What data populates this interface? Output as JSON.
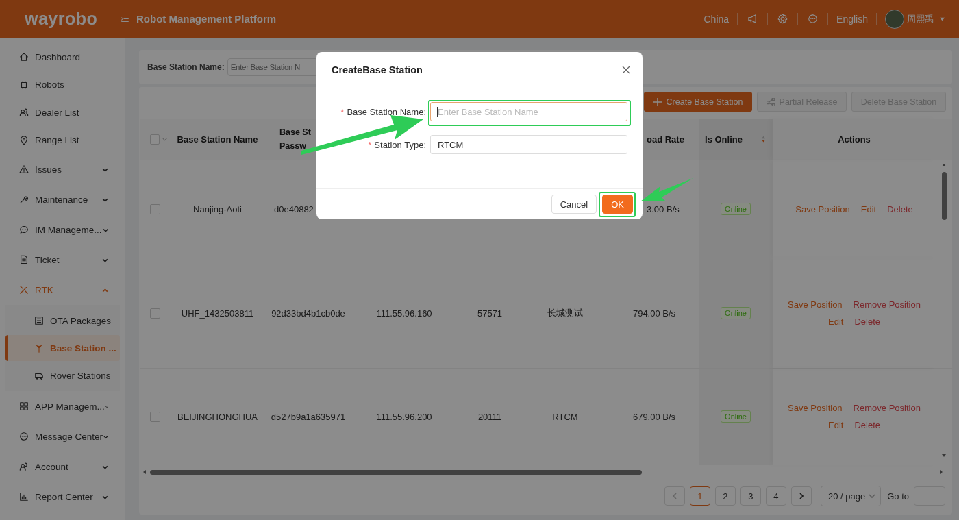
{
  "header": {
    "logo": "wayrobo",
    "title": "Robot Management Platform",
    "region": "China",
    "language": "English",
    "user": "周熙禹"
  },
  "sidebar": {
    "items": [
      {
        "label": "Dashboard",
        "kind": "link",
        "selected": false
      },
      {
        "label": "Robots",
        "kind": "link",
        "selected": false
      },
      {
        "label": "Dealer List",
        "kind": "link",
        "selected": false
      },
      {
        "label": "Range List",
        "kind": "link",
        "selected": false
      },
      {
        "label": "Issues",
        "kind": "group",
        "expanded": false,
        "selected": false
      },
      {
        "label": "Maintenance",
        "kind": "group",
        "expanded": false,
        "selected": false
      },
      {
        "label": "IM Manageme...",
        "kind": "group",
        "expanded": false,
        "selected": false
      },
      {
        "label": "Ticket",
        "kind": "group",
        "expanded": false,
        "selected": false
      },
      {
        "label": "RTK",
        "kind": "group",
        "expanded": true,
        "selected": true,
        "children": [
          {
            "label": "OTA Packages",
            "selected": false
          },
          {
            "label": "Base Station ...",
            "selected": true
          },
          {
            "label": "Rover Stations",
            "selected": false
          }
        ]
      },
      {
        "label": "APP Managem...",
        "kind": "group",
        "expanded": false,
        "selected": false
      },
      {
        "label": "Message Center",
        "kind": "group",
        "expanded": false,
        "selected": false
      },
      {
        "label": "Account",
        "kind": "group",
        "expanded": false,
        "selected": false
      },
      {
        "label": "Report Center",
        "kind": "group",
        "expanded": false,
        "selected": false
      }
    ]
  },
  "filter": {
    "label": "Base Station Name:",
    "placeholder": "Enter Base Station N"
  },
  "toolbar": [
    {
      "label": "Create Base Station",
      "kind": "create",
      "disabled": false
    },
    {
      "label": "Partial Release",
      "kind": "release",
      "disabled": true
    },
    {
      "label": "Delete Base Station",
      "kind": "plain",
      "disabled": true
    }
  ],
  "table": {
    "header": {
      "all_selected": false,
      "name": "Base Station Name",
      "password": [
        "Base St",
        "Passw"
      ],
      "rate": "oad Rate",
      "online": "Is Online",
      "descending": true,
      "actions": "Actions"
    },
    "rows": [
      {
        "selected": false,
        "name": "Nanjing-Aoti",
        "password": "d0e40882",
        "rate": "3.00 B/s",
        "status": "Online",
        "online": true,
        "actions": [
          {
            "label": "Save Position",
            "kind": "primary"
          },
          {
            "label": "Edit",
            "kind": "primary"
          },
          {
            "label": "Delete",
            "kind": "danger"
          }
        ]
      },
      {
        "selected": false,
        "name": "UHF_1432503811",
        "password": "92d33bd4b1cb0de",
        "ip": "111.55.96.160",
        "port": "57571",
        "type": "长城测试",
        "rate": "794.00 B/s",
        "status": "Online",
        "online": true,
        "actions": [
          {
            "label": "Save Position",
            "kind": "primary"
          },
          {
            "label": "Remove Position",
            "kind": "danger"
          },
          {
            "label": "Edit",
            "kind": "primary"
          },
          {
            "label": "Delete",
            "kind": "danger"
          }
        ]
      },
      {
        "selected": false,
        "name": "BEIJINGHONGHUA",
        "password": "d527b9a1a635971",
        "ip": "111.55.96.200",
        "port": "20111",
        "type": "RTCM",
        "rate": "679.00 B/s",
        "status": "Online",
        "online": true,
        "actions": [
          {
            "label": "Save Position",
            "kind": "primary"
          },
          {
            "label": "Remove Position",
            "kind": "danger"
          },
          {
            "label": "Edit",
            "kind": "primary"
          },
          {
            "label": "Delete",
            "kind": "danger"
          }
        ]
      }
    ]
  },
  "pagination": {
    "pages": [
      {
        "label": "1",
        "selected": true
      },
      {
        "label": "2",
        "selected": false
      },
      {
        "label": "3",
        "selected": false
      },
      {
        "label": "4",
        "selected": false
      }
    ],
    "page_size": "20 / page",
    "goto_label": "Go to"
  },
  "modal": {
    "title": "CreateBase Station",
    "fields": [
      {
        "label": "Base Station Name:",
        "mark": "*",
        "placeholder": "Enter Base Station Name",
        "focused": true
      },
      {
        "label": "Station Type:",
        "mark": "*",
        "value": "RTCM",
        "focused": false
      }
    ],
    "buttons": [
      {
        "label": "Cancel",
        "kind": "default"
      },
      {
        "label": "OK",
        "kind": "primary"
      }
    ]
  }
}
